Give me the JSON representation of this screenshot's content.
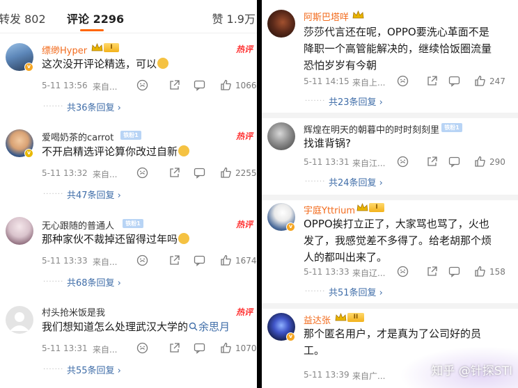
{
  "left": {
    "tabs": {
      "reposts": "转发 802",
      "comments": "评论 2296",
      "likes": "赞 1.9万"
    },
    "comments": [
      {
        "user": "缥缈Hyper",
        "level": "I",
        "hot": "热评",
        "text": "这次没开评论精选，可以",
        "time": "5-11 13:56",
        "source": "来自...",
        "likes": "1066",
        "replies": "共36条回复"
      },
      {
        "user": "爱喝奶茶的carrot",
        "badge": "铁粉1",
        "hot": "热评",
        "text": "不开启精选评论算你改过自新",
        "time": "5-11 13:32",
        "source": "来自...",
        "likes": "2255",
        "replies": "共47条回复"
      },
      {
        "user": "无心跟随的普通人",
        "badge": "铁粉1",
        "hot": "热评",
        "text": "那种家伙不裁掉还留得过年吗",
        "time": "5-11 13:33",
        "source": "来自...",
        "likes": "1674",
        "replies": "共68条回复"
      },
      {
        "user": "村头抢米饭是我",
        "hot": "热评",
        "text": "我们想知道怎么处理武汉大学的",
        "search_term": "余思月",
        "time": "5-11 13:31",
        "source": "来自...",
        "likes": "1070",
        "replies": "共55条回复"
      }
    ]
  },
  "right": {
    "comments": [
      {
        "user": "阿斯巴塔咩",
        "text_lines": [
          "莎莎代言还在呢，OPPO要洗心革面不是",
          "降职一个高管能解决的，继续恰饭圈流量",
          "恐怕岁岁有今朝"
        ],
        "time": "5-11 14:15",
        "source": "来自上...",
        "likes": "247",
        "replies": "共23条回复"
      },
      {
        "user": "辉煌在明天的朝暮中的时时刻刻里",
        "badge": "铁粉1",
        "text_lines": [
          "找谁背锅?"
        ],
        "time": "5-11 13:31",
        "source": "来自江...",
        "likes": "290",
        "replies": "共24条回复"
      },
      {
        "user": "宇庭Yttrium",
        "level": "I",
        "text_lines": [
          "OPPO挨打立正了，大家骂也骂了，火也",
          "发了，我感觉差不多得了。给老胡那个烦",
          "人的都叫出来了。"
        ],
        "time": "5-11 13:33",
        "source": "来自辽...",
        "likes": "158",
        "replies": "共51条回复"
      },
      {
        "user": "益达张",
        "level": "II",
        "text_lines": [
          "那个匿名用户，才是真为了公司好的员",
          "工。"
        ],
        "time": "5-11 13:39",
        "source": "来自广..."
      }
    ],
    "watermark": "知乎 @针探STI"
  },
  "colors": {
    "accent": "#f26b1d",
    "link": "#3f6da8",
    "hot": "#ff3333"
  }
}
